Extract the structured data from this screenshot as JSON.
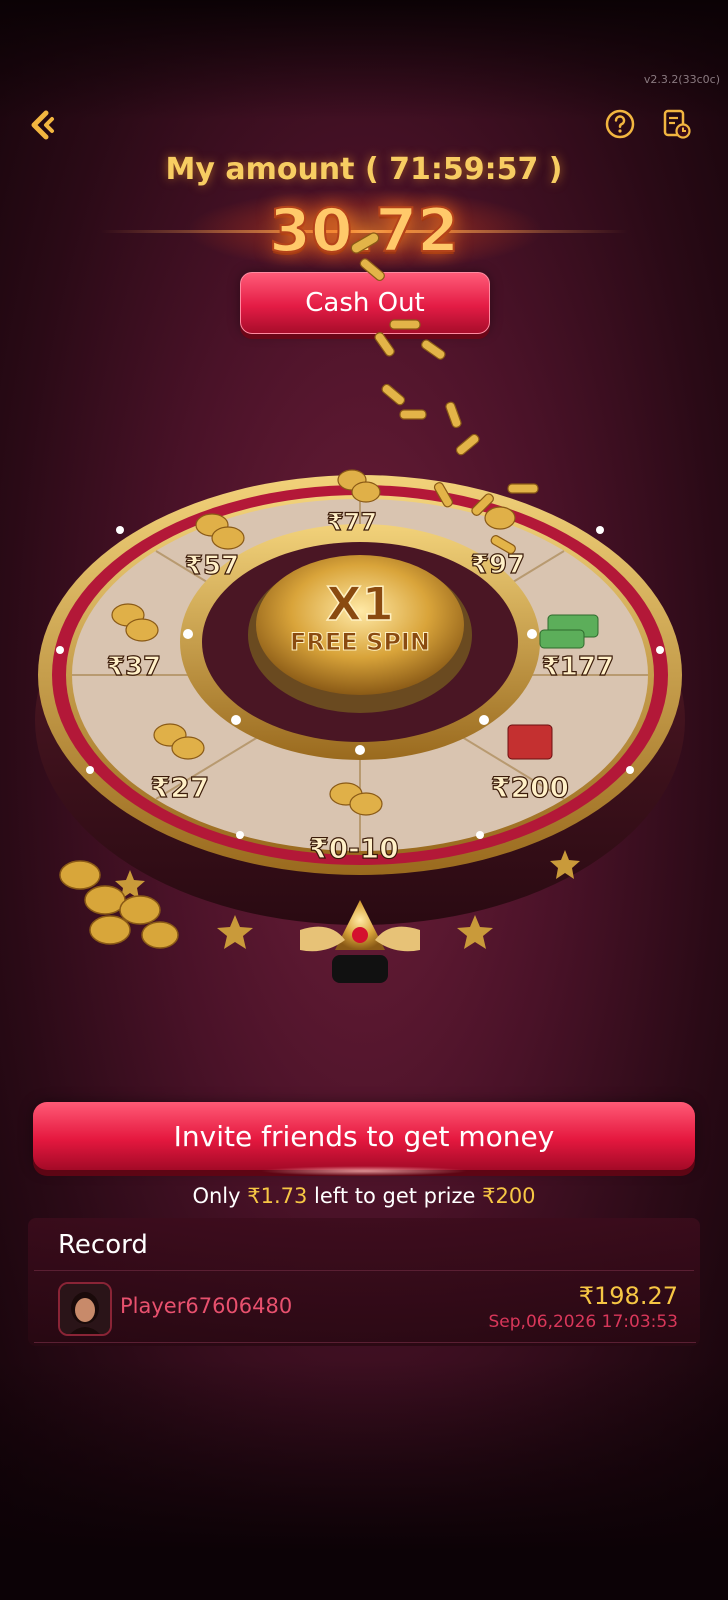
{
  "header": {
    "version": "v2.3.2(33c0c)",
    "amount_label": "My amount ( 71:59:57 )",
    "amount_value": "30.72",
    "cashout_label": "Cash Out"
  },
  "wheel": {
    "center_multiplier": "X1",
    "center_label": "FREE SPIN",
    "segments": [
      {
        "label": "₹77"
      },
      {
        "label": "₹97"
      },
      {
        "label": "₹177"
      },
      {
        "label": "₹200"
      },
      {
        "label": "₹0-10"
      },
      {
        "label": "₹27"
      },
      {
        "label": "₹37"
      },
      {
        "label": "₹57"
      }
    ]
  },
  "invite": {
    "button_label": "Invite friends to get money",
    "prize_prefix": "Only",
    "prize_remaining": "₹1.73",
    "prize_middle": "left to get prize",
    "prize_target": "₹200"
  },
  "records": {
    "title": "Record",
    "items": [
      {
        "player": "Player67606480",
        "amount": "₹198.27",
        "time": "Sep,06,2026 17:03:53"
      }
    ]
  },
  "colors": {
    "accent_gold": "#f6c644",
    "button_red": "#e41c45",
    "background": "#4a1228"
  }
}
